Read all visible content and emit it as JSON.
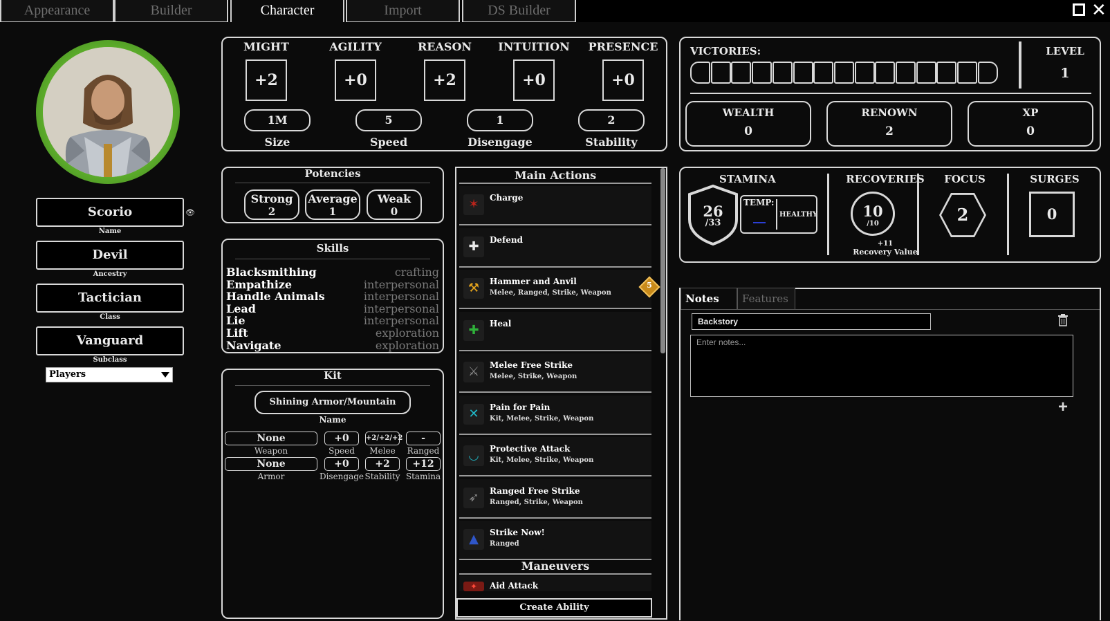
{
  "tabs": [
    "Appearance",
    "Builder",
    "Character",
    "Import",
    "DS Builder"
  ],
  "active_tab": "Character",
  "hero": {
    "name": "Scorio",
    "name_caption": "Name",
    "ancestry": "Devil",
    "ancestry_caption": "Ancestry",
    "class": "Tactician",
    "class_caption": "Class",
    "subclass": "Vanguard",
    "subclass_caption": "Subclass",
    "visibility_select": "Players"
  },
  "characteristics": [
    {
      "label": "MIGHT",
      "value": "+2"
    },
    {
      "label": "AGILITY",
      "value": "+0"
    },
    {
      "label": "REASON",
      "value": "+2"
    },
    {
      "label": "INTUITION",
      "value": "+0"
    },
    {
      "label": "PRESENCE",
      "value": "+0"
    }
  ],
  "derived": [
    {
      "label": "Size",
      "value": "1M"
    },
    {
      "label": "Speed",
      "value": "5"
    },
    {
      "label": "Disengage",
      "value": "1"
    },
    {
      "label": "Stability",
      "value": "2"
    }
  ],
  "victories": {
    "label": "VICTORIES:",
    "count": 0,
    "boxes": 15
  },
  "level": {
    "label": "LEVEL",
    "value": "1"
  },
  "resources": [
    {
      "label": "WEALTH",
      "value": "0"
    },
    {
      "label": "RENOWN",
      "value": "2"
    },
    {
      "label": "XP",
      "value": "0"
    }
  ],
  "potencies": {
    "title": "Potencies",
    "items": [
      {
        "label": "Strong",
        "value": "2"
      },
      {
        "label": "Average",
        "value": "1"
      },
      {
        "label": "Weak",
        "value": "0"
      }
    ]
  },
  "skills": {
    "title": "Skills",
    "items": [
      {
        "name": "Blacksmithing",
        "category": "crafting"
      },
      {
        "name": "Empathize",
        "category": "interpersonal"
      },
      {
        "name": "Handle Animals",
        "category": "interpersonal"
      },
      {
        "name": "Lead",
        "category": "interpersonal"
      },
      {
        "name": "Lie",
        "category": "interpersonal"
      },
      {
        "name": "Lift",
        "category": "exploration"
      },
      {
        "name": "Navigate",
        "category": "exploration"
      }
    ]
  },
  "kit": {
    "title": "Kit",
    "name": "Shining Armor/Mountain",
    "name_caption": "Name",
    "row1": [
      {
        "label": "Weapon",
        "value": "None"
      },
      {
        "label": "Speed",
        "value": "+0"
      },
      {
        "label": "Melee",
        "value": "+2/+2/+2"
      },
      {
        "label": "Ranged",
        "value": "-"
      }
    ],
    "row2": [
      {
        "label": "Armor",
        "value": "None"
      },
      {
        "label": "Disengage",
        "value": "+0"
      },
      {
        "label": "Stability",
        "value": "+2"
      },
      {
        "label": "Stamina",
        "value": "+12"
      }
    ]
  },
  "actions": {
    "main_title": "Main Actions",
    "main": [
      {
        "name": "Charge",
        "keywords": "",
        "icon": "charge-icon",
        "color": "#c0241b"
      },
      {
        "name": "Defend",
        "keywords": "",
        "icon": "shield-cross-icon",
        "color": "#e8e8e8"
      },
      {
        "name": "Hammer and Anvil",
        "keywords": "Melee, Ranged, Strike, Weapon",
        "icon": "anvil-icon",
        "color": "#e2a21c"
      },
      {
        "name": "Heal",
        "keywords": "",
        "icon": "heal-icon",
        "color": "#2fb13a"
      },
      {
        "name": "Melee Free Strike",
        "keywords": "Melee, Strike, Weapon",
        "icon": "sword-icon",
        "color": "#8c8c8c"
      },
      {
        "name": "Pain for Pain",
        "keywords": "Kit, Melee, Strike, Weapon",
        "icon": "crossed-swords-icon",
        "color": "#1fb7c7"
      },
      {
        "name": "Protective Attack",
        "keywords": "Kit, Melee, Strike, Weapon",
        "icon": "protective-icon",
        "color": "#1fa9b5"
      },
      {
        "name": "Ranged Free Strike",
        "keywords": "Ranged, Strike, Weapon",
        "icon": "bow-icon",
        "color": "#8c8c8c"
      },
      {
        "name": "Strike Now!",
        "keywords": "Ranged",
        "icon": "arrow-up-icon",
        "color": "#2f56c9"
      }
    ],
    "hammer_cost": "5",
    "maneuvers_title": "Maneuvers",
    "maneuvers": [
      {
        "name": "Aid Attack",
        "icon": "aid-attack-icon",
        "color": "#c0241b"
      }
    ],
    "create_label": "Create Ability"
  },
  "vitals": {
    "stamina_label": "STAMINA",
    "stamina_current": "26",
    "stamina_max": "/33",
    "temp_label": "TEMP:",
    "status": "HEALTHY",
    "recoveries_label": "RECOVERIES",
    "recoveries_current": "10",
    "recoveries_max": "/10",
    "recovery_value": "+11",
    "recovery_value_label": "Recovery Value",
    "focus_label": "FOCUS",
    "focus_value": "2",
    "surges_label": "SURGES",
    "surges_value": "0"
  },
  "notes": {
    "tabs": [
      "Notes",
      "Features"
    ],
    "title_value": "Backstory",
    "placeholder": "Enter notes..."
  },
  "colors": {
    "accent_green": "#5fb22b",
    "temp_blue": "#2b3fd6",
    "border": "#d9d9d9"
  }
}
